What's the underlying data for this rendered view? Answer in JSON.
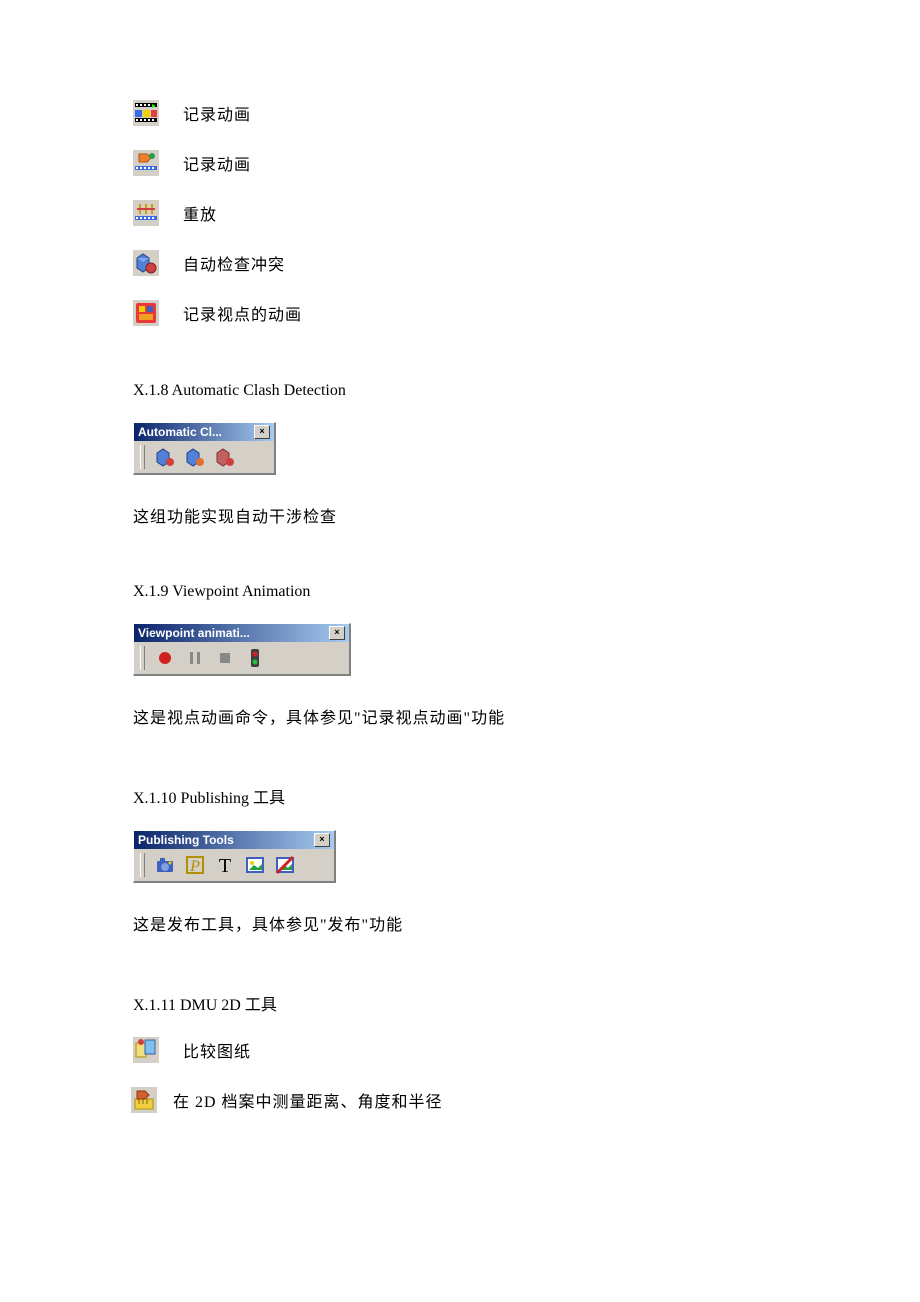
{
  "icon_list_top": [
    {
      "name": "record-anim-1-icon",
      "label": "记录动画"
    },
    {
      "name": "record-anim-2-icon",
      "label": "记录动画"
    },
    {
      "name": "replay-icon",
      "label": "重放"
    },
    {
      "name": "auto-clash-icon",
      "label": "自动检查冲突"
    },
    {
      "name": "record-viewpoint-icon",
      "label": "记录视点的动画"
    }
  ],
  "sections": {
    "clash": {
      "heading": "X.1.8 Automatic Clash Detection",
      "toolbar_title": "Automatic Cl...",
      "body": "这组功能实现自动干涉检查"
    },
    "viewpoint": {
      "heading": "X.1.9 Viewpoint Animation",
      "toolbar_title": "Viewpoint animati...",
      "body": "这是视点动画命令，具体参见\"记录视点动画\"功能"
    },
    "publishing": {
      "heading": "X.1.10 Publishing  工具",
      "toolbar_title": "Publishing Tools",
      "body": "这是发布工具，具体参见\"发布\"功能"
    },
    "dmu2d": {
      "heading": "X.1.11 DMU 2D  工具",
      "items": [
        {
          "name": "compare-drawing-icon",
          "label": "比较图纸"
        },
        {
          "name": "measure-2d-icon",
          "label": "在 2D 档案中测量距离、角度和半径"
        }
      ]
    }
  },
  "close_label": "×"
}
